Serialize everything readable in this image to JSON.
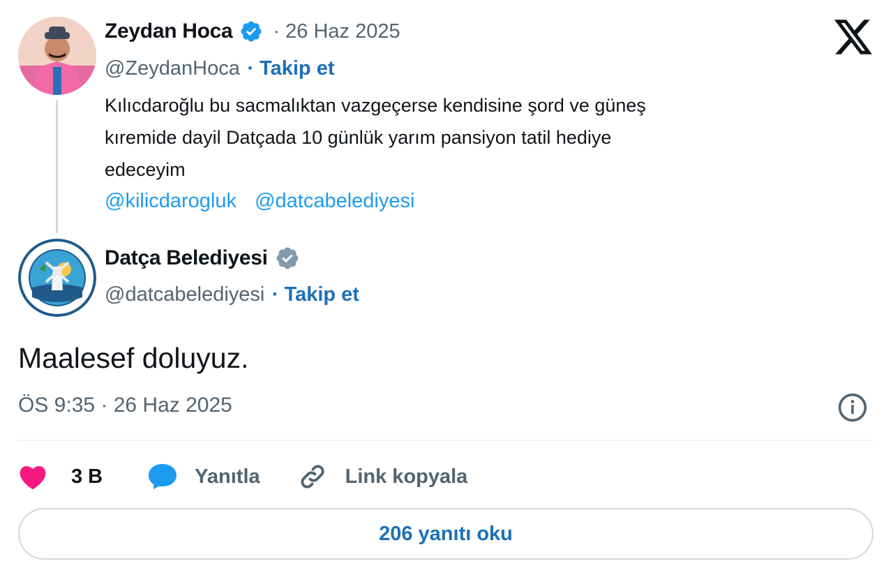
{
  "quoted_tweet": {
    "author": {
      "name": "Zeydan Hoca",
      "handle": "@ZeydanHoca",
      "verified": true,
      "verified_color": "#1d9bf0"
    },
    "date": "· 26 Haz 2025",
    "follow_label": "· Takip et",
    "text_lines": [
      "Kılıcdaroğlu bu sacmalıktan  vazgeçerse  kendisine şord ve güneş",
      "kıremide dayil Datçada  10 günlük yarım pansiyon tatil hediye",
      "edeceyim"
    ],
    "mentions": [
      "@kilicdarogluk",
      "@datcabelediyesi"
    ]
  },
  "reply_tweet": {
    "author": {
      "name": "Datça Belediyesi",
      "handle": "@datcabelediyesi",
      "verified": true,
      "verified_color": "#829aab"
    },
    "follow_label": "· Takip et",
    "text": "Maalesef doluyuz.",
    "timestamp": "ÖS 9:35 · 26 Haz 2025"
  },
  "actions": {
    "like_count": "3 B",
    "reply_label": "Yanıtla",
    "copy_link_label": "Link kopyala"
  },
  "read_replies_label": "206 yanıtı oku",
  "colors": {
    "accent": "#1d9bf0",
    "like": "#f91880",
    "muted": "#536471",
    "text": "#0f1419"
  },
  "icons": [
    "x-logo-icon",
    "verified-badge-icon",
    "info-icon",
    "heart-icon",
    "reply-bubble-icon",
    "link-icon"
  ]
}
